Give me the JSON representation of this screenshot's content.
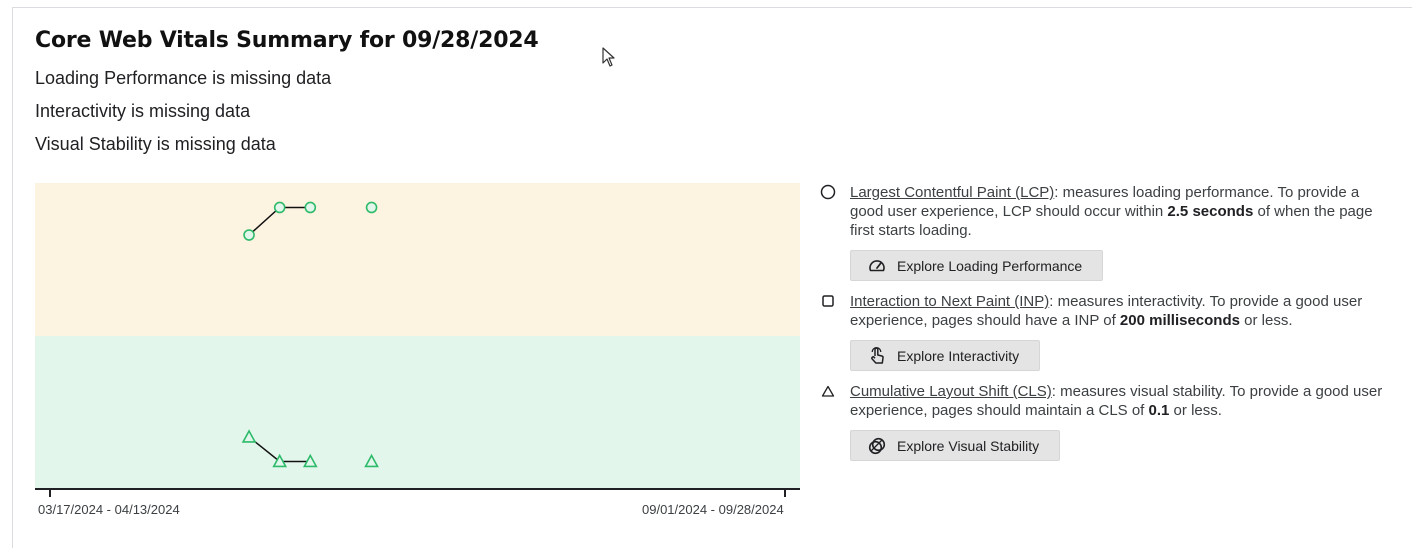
{
  "summary": {
    "title": "Core Web Vitals Summary for 09/28/2024",
    "loading_status": "Loading Performance is missing data",
    "interactivity_status": "Interactivity is missing data",
    "stability_status": "Visual Stability is missing data"
  },
  "chart_data": {
    "type": "line",
    "x_labels": [
      "03/17/2024 - 04/13/2024",
      "09/01/2024 - 09/28/2024"
    ],
    "bands": [
      {
        "name": "needs-improvement",
        "color": "#fdf3e1"
      },
      {
        "name": "good",
        "color": "#e3f6ec"
      }
    ],
    "series": [
      {
        "metric": "LCP",
        "marker": "circle",
        "color": "#2dbb6a",
        "points": [
          [
            3.25,
            0.83
          ],
          [
            3.75,
            0.92
          ],
          [
            4.25,
            0.92
          ],
          [
            5.25,
            0.92
          ]
        ],
        "segments": [
          [
            0,
            2
          ]
        ]
      },
      {
        "metric": "CLS",
        "marker": "triangle",
        "color": "#2dbb6a",
        "points": [
          [
            3.25,
            0.17
          ],
          [
            3.75,
            0.09
          ],
          [
            4.25,
            0.09
          ],
          [
            5.25,
            0.09
          ]
        ],
        "segments": [
          [
            0,
            2
          ]
        ]
      }
    ]
  },
  "metrics": [
    {
      "link": "Largest Contentful Paint (LCP)",
      "desc_pre": ": measures loading performance. To provide a good user experience, LCP should occur within ",
      "highlight": "2.5 seconds",
      "desc_post": " of when the page first starts loading.",
      "button": "Explore Loading Performance",
      "icon": "gauge-icon"
    },
    {
      "link": "Interaction to Next Paint (INP)",
      "desc_pre": ": measures interactivity. To provide a good user experience, pages should have a INP of ",
      "highlight": "200 milliseconds",
      "desc_post": " or less.",
      "button": "Explore Interactivity",
      "icon": "touch-icon"
    },
    {
      "link": "Cumulative Layout Shift (CLS)",
      "desc_pre": ": measures visual stability. To provide a good user experience, pages should maintain a CLS of ",
      "highlight": "0.1",
      "desc_post": " or less.",
      "button": "Explore Visual Stability",
      "icon": "layers-icon"
    }
  ]
}
